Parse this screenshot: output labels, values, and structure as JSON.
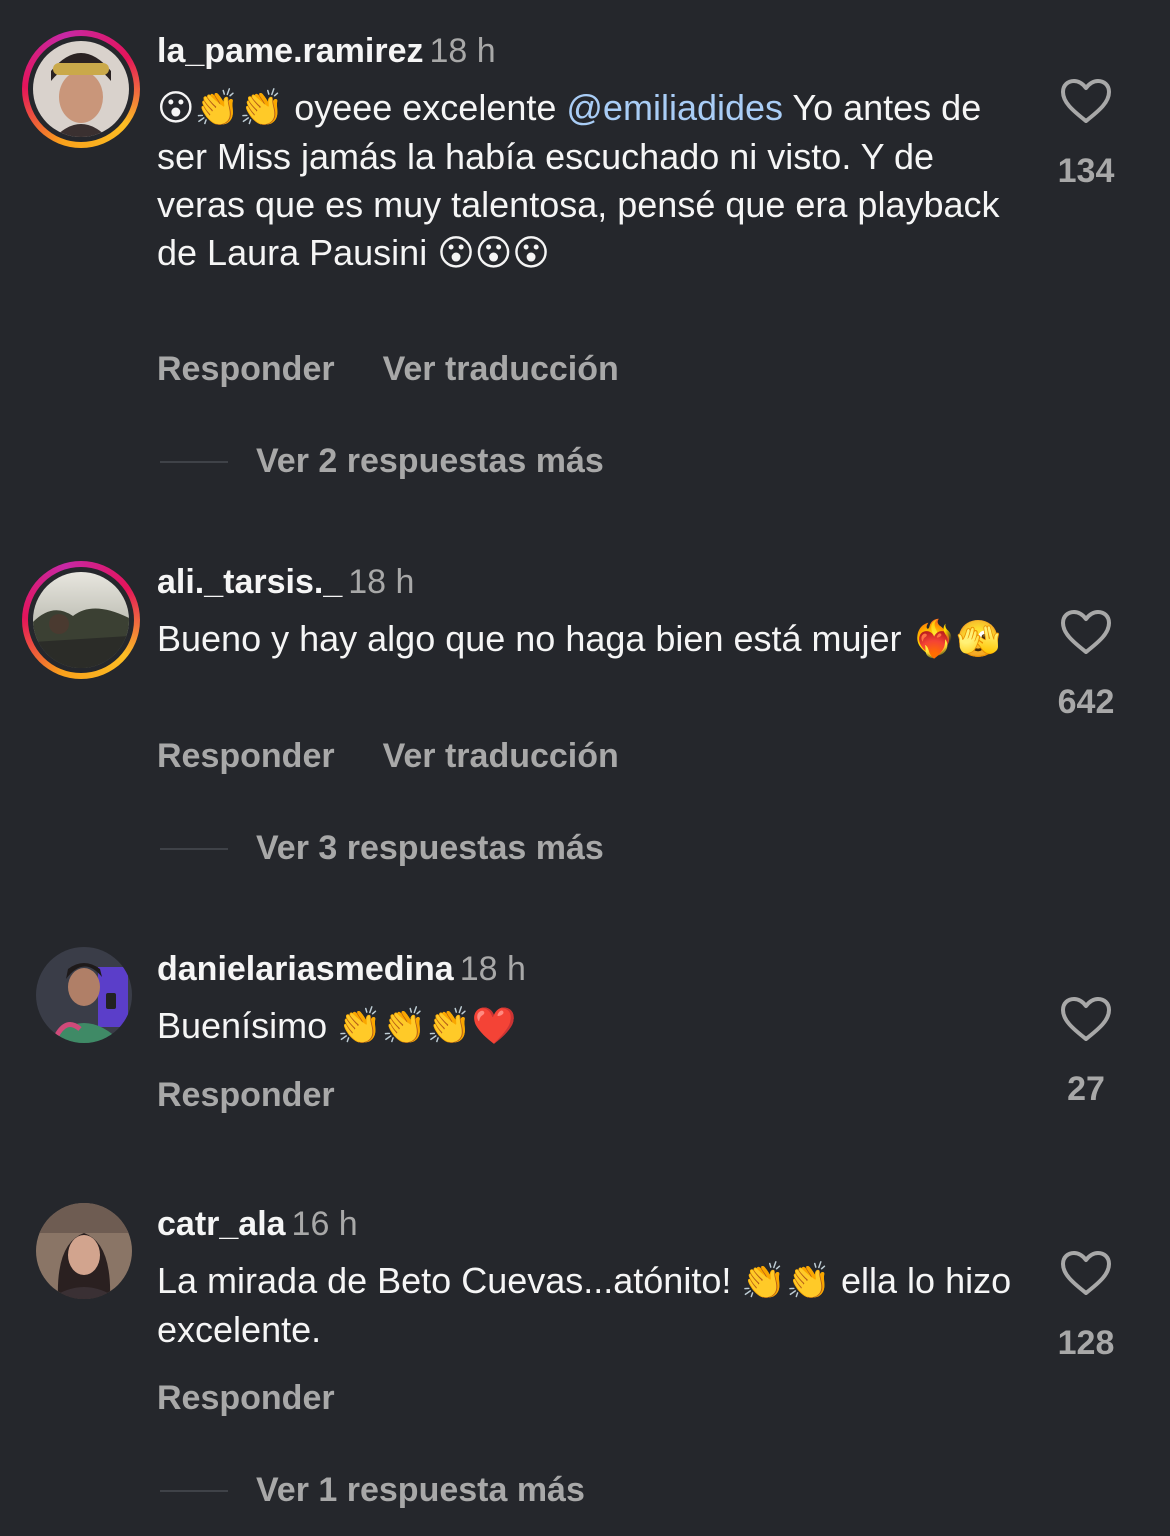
{
  "comments": [
    {
      "username": "la_pame.ramirez",
      "time": "18 h",
      "emoji_prefix": "😮👏👏",
      "text_before_mention": " oyeee excelente ",
      "mention": "@emiliadides",
      "text_after_mention": " Yo antes de ser Miss jamás la había escuchado ni visto. Y de veras que es muy talentosa, pensé que era playback de Laura Pausini ",
      "emoji_suffix": "😮😮😮",
      "reply_label": "Responder",
      "translate_label": "Ver traducción",
      "likes": "134",
      "more_replies": "Ver 2 respuestas más"
    },
    {
      "username": "ali._tarsis._",
      "time": "18 h",
      "text": "Bueno y hay algo que no haga bien está mujer ",
      "emoji_suffix": "❤️‍🔥🫣",
      "reply_label": "Responder",
      "translate_label": "Ver traducción",
      "likes": "642",
      "more_replies": "Ver 3 respuestas más"
    },
    {
      "username": "danielariasmedina",
      "time": "18 h",
      "text": "Buenísimo ",
      "emoji_suffix": "👏👏👏❤️",
      "reply_label": "Responder",
      "likes": "27"
    },
    {
      "username": "catr_ala",
      "time": "16 h",
      "text": "La mirada de Beto Cuevas...atónito! ",
      "emoji_mid": "👏👏",
      "text_after": " ella lo hizo excelente.",
      "reply_label": "Responder",
      "likes": "128",
      "more_replies": "Ver 1 respuesta más"
    }
  ],
  "colors": {
    "background": "#25272c",
    "text": "#f5f5f5",
    "secondary": "#a8a8a8",
    "mention": "#a9cdf6"
  },
  "icons": {
    "like": "heart-outline-icon"
  }
}
